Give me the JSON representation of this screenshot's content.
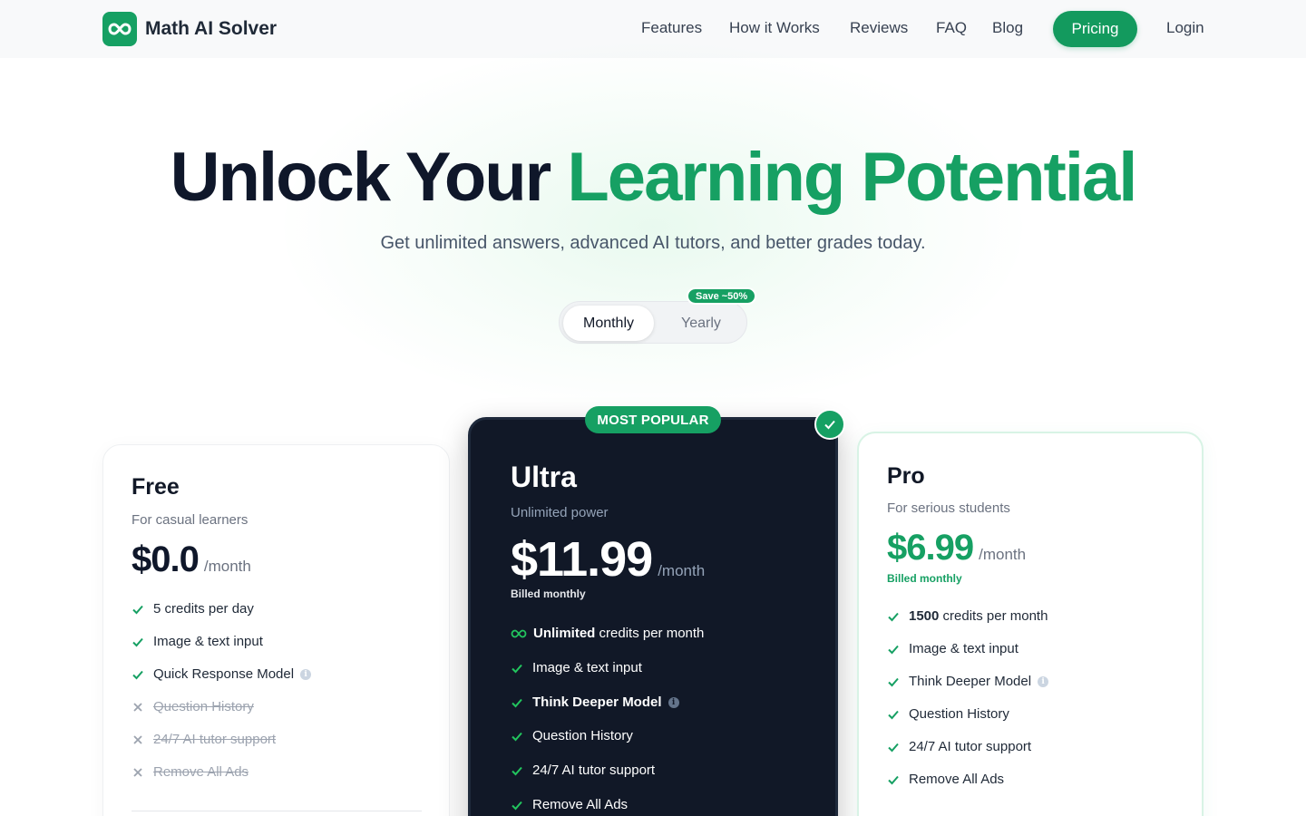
{
  "nav": {
    "brand": "Math AI Solver",
    "links": [
      "Features",
      "How it Works",
      "Reviews",
      "FAQ",
      "Blog"
    ],
    "pricing": "Pricing",
    "login": "Login"
  },
  "hero": {
    "title_dark": "Unlock Your",
    "title_accent": "Learning Potential",
    "subtitle": "Get unlimited answers, advanced AI tutors, and better grades today."
  },
  "billing_toggle": {
    "monthly": "Monthly",
    "yearly": "Yearly",
    "save_badge": "Save ~50%",
    "selected": "Monthly"
  },
  "plans": {
    "free": {
      "name": "Free",
      "desc": "For casual learners",
      "price": "$0.0",
      "period": "/month",
      "features": [
        {
          "text": "5 credits per day",
          "included": true
        },
        {
          "text": "Image & text input",
          "included": true
        },
        {
          "text": "Quick Response Model",
          "included": true,
          "info": true
        },
        {
          "text": "Question History",
          "included": false
        },
        {
          "text": "24/7 AI tutor support",
          "included": false
        },
        {
          "text": "Remove All Ads",
          "included": false
        }
      ]
    },
    "ultra": {
      "badge": "MOST POPULAR",
      "name": "Ultra",
      "desc": "Unlimited power",
      "price": "$11.99",
      "period": "/month",
      "billed": "Billed monthly",
      "features": [
        {
          "bold": "Unlimited",
          "text": " credits per month",
          "icon": "infinity"
        },
        {
          "text": "Image & text input"
        },
        {
          "bold": "Think Deeper Model",
          "text": "",
          "info": true
        },
        {
          "text": "Question History"
        },
        {
          "text": "24/7 AI tutor support"
        },
        {
          "text": "Remove All Ads"
        }
      ]
    },
    "pro": {
      "name": "Pro",
      "desc": "For serious students",
      "price": "$6.99",
      "period": "/month",
      "billed": "Billed monthly",
      "features": [
        {
          "bold": "1500",
          "text": " credits per month"
        },
        {
          "text": "Image & text input"
        },
        {
          "text": "Think Deeper Model",
          "info": true
        },
        {
          "text": "Question History"
        },
        {
          "text": "24/7 AI tutor support"
        },
        {
          "text": "Remove All Ads"
        }
      ]
    }
  },
  "colors": {
    "accent": "#16a063",
    "dark_card": "#111827",
    "text_dark": "#0f172a"
  }
}
